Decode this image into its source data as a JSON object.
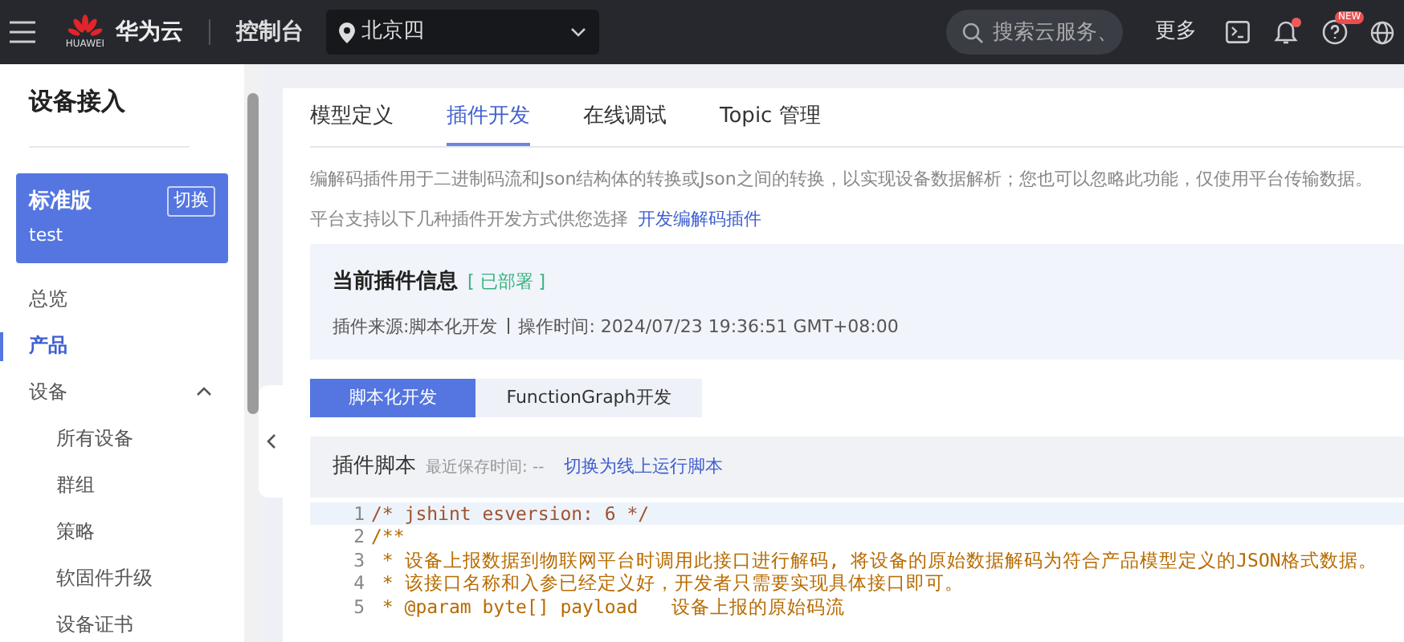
{
  "header": {
    "brand": "华为云",
    "logo_text": "HUAWEI",
    "console": "控制台",
    "region": "北京四",
    "search": {
      "placeholder": "搜索云服务、"
    },
    "more": "更多",
    "notification_dot": true,
    "help_badge": "NEW"
  },
  "sidebar": {
    "title": "设备接入",
    "edition": {
      "name": "标准版",
      "switch": "切换",
      "instance": "test"
    },
    "items": [
      {
        "label": "总览",
        "selected": false
      },
      {
        "label": "产品",
        "selected": true
      },
      {
        "label": "设备",
        "selected": false,
        "expanded": true,
        "children": [
          {
            "label": "所有设备",
            "selected": false
          },
          {
            "label": "群组",
            "selected": false
          },
          {
            "label": "策略",
            "selected": false
          },
          {
            "label": "软固件升级",
            "selected": false
          },
          {
            "label": "设备证书",
            "selected": false
          }
        ]
      }
    ]
  },
  "tabs": [
    {
      "label": "模型定义",
      "selected": false
    },
    {
      "label": "插件开发",
      "selected": true
    },
    {
      "label": "在线调试",
      "selected": false
    },
    {
      "label": "Topic 管理",
      "selected": false
    }
  ],
  "description": "编解码插件用于二进制码流和Json结构体的转换或Json之间的转换，以实现设备数据解析；您也可以忽略此功能，仅使用平台传输数据。",
  "methods_text": "平台支持以下几种插件开发方式供您选择",
  "methods_link": "开发编解码插件",
  "plugin_info": {
    "title": "当前插件信息",
    "status": "[ 已部署 ]",
    "source": "插件来源:脚本化开发",
    "time": "操作时间: 2024/07/23 19:36:51 GMT+08:00"
  },
  "dev_modes": [
    {
      "label": "脚本化开发",
      "selected": true
    },
    {
      "label": "FunctionGraph开发",
      "selected": false
    }
  ],
  "script": {
    "title": "插件脚本",
    "saved": "最近保存时间: --",
    "switch_link": "切换为线上运行脚本",
    "lines": [
      {
        "number": "1",
        "text": "/* jshint esversion: 6 */",
        "current": true
      },
      {
        "number": "2",
        "text": "/**",
        "current": false
      },
      {
        "number": "3",
        "text": " * 设备上报数据到物联网平台时调用此接口进行解码, 将设备的原始数据解码为符合产品模型定义的JSON格式数据。",
        "current": false
      },
      {
        "number": "4",
        "text": " * 该接口名称和入参已经定义好，开发者只需要实现具体接口即可。",
        "current": false
      },
      {
        "number": "5",
        "text": " * @param byte[] payload   设备上报的原始码流",
        "current": false
      }
    ]
  }
}
